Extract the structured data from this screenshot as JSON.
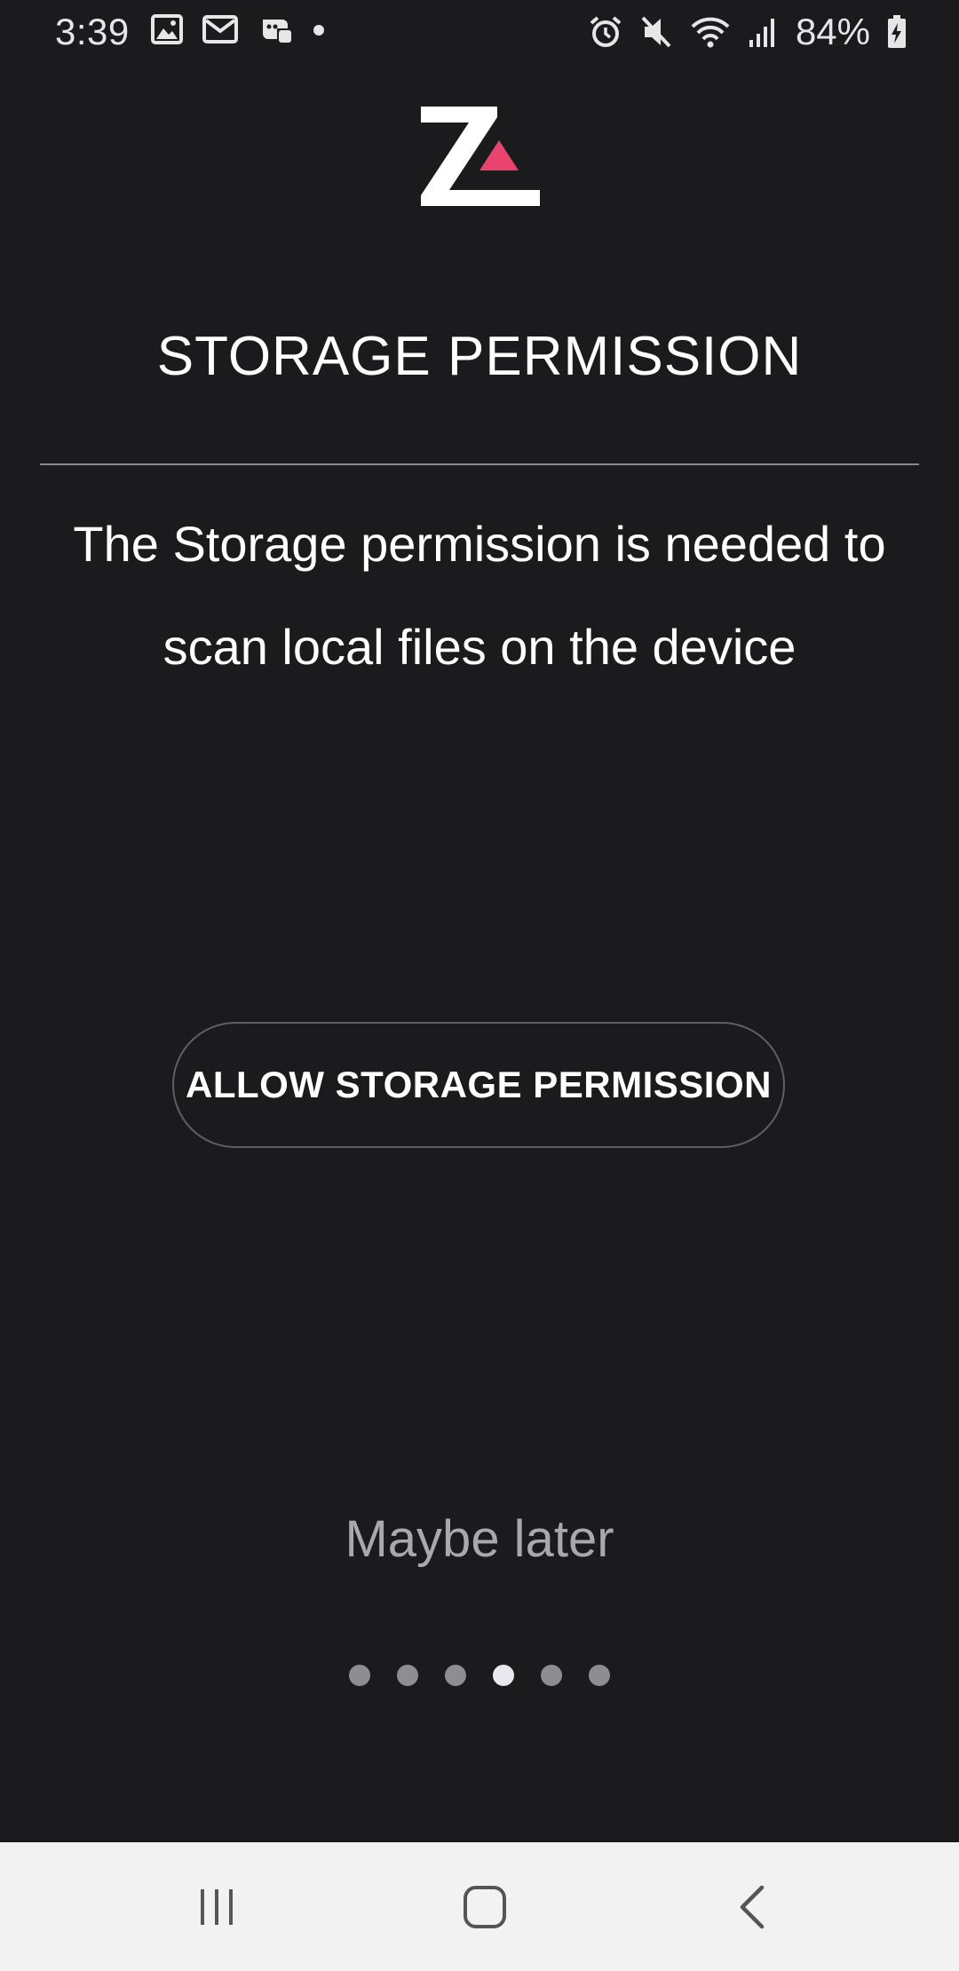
{
  "status_bar": {
    "time": "3:39",
    "battery_percent": "84%",
    "left_icons": [
      "gallery-icon",
      "email-icon",
      "game-controller-icon",
      "dot-icon"
    ],
    "right_icons": [
      "alarm-icon",
      "mute-icon",
      "wifi-icon",
      "signal-icon",
      "battery-charging-icon"
    ]
  },
  "logo": {
    "icon": "zonealarm-z-logo",
    "accent_color": "#e8446d"
  },
  "onboarding": {
    "title": "STORAGE PERMISSION",
    "description_line1": "The Storage permission is needed to",
    "description_line2": "scan local files on the device",
    "allow_button_label": "ALLOW STORAGE PERMISSION",
    "maybe_later_label": "Maybe later",
    "page_count": 6,
    "current_page": 4
  },
  "nav_bar": {
    "recents_icon": "recents-icon",
    "home_icon": "home-icon",
    "back_icon": "back-icon"
  },
  "colors": {
    "background": "#1b1b1d",
    "text": "#ffffff",
    "muted_text": "#a9a9ad",
    "nav_background": "#f2f2f2"
  }
}
